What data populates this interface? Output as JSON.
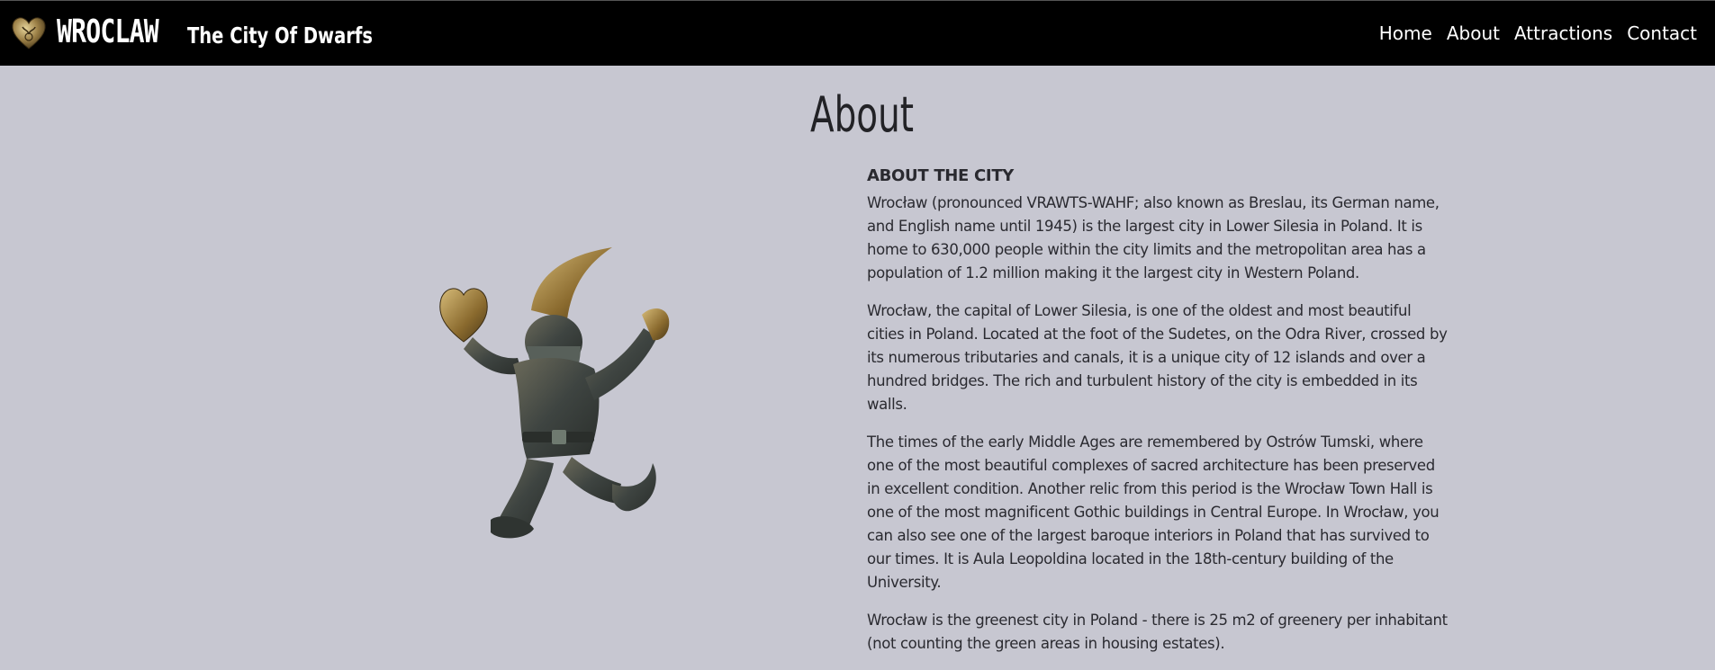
{
  "header": {
    "brand_name": "WROCLAW",
    "brand_tagline": "The City Of Dwarfs",
    "logo_icon": "bronze-heart-icon",
    "nav": [
      {
        "label": "Home"
      },
      {
        "label": "About"
      },
      {
        "label": "Attractions"
      },
      {
        "label": "Contact"
      }
    ]
  },
  "main": {
    "title": "About",
    "image_icon": "bronze-dwarf-statue",
    "section_heading": "ABOUT THE CITY",
    "paragraphs": [
      "Wrocław (pronounced VRAWTS-WAHF; also known as Breslau, its German name, and English name until 1945) is the largest city in Lower Silesia in Poland. It is home to 630,000 people within the city limits and the metropolitan area has a population of 1.2 million making it the largest city in Western Poland.",
      "Wrocław, the capital of Lower Silesia, is one of the oldest and most beautiful cities in Poland. Located at the foot of the Sudetes, on the Odra River, crossed by its numerous tributaries and canals, it is a unique city of 12 islands and over a hundred bridges. The rich and turbulent history of the city is embedded in its walls.",
      "The times of the early Middle Ages are remembered by Ostrów Tumski, where one of the most beautiful complexes of sacred architecture has been preserved in excellent condition. Another relic from this period is the Wrocław Town Hall is one of the most magnificent Gothic buildings in Central Europe. In Wrocław, you can also see one of the largest baroque interiors in Poland that has survived to our times. It is Aula Leopoldina located in the 18th-century building of the University.",
      "Wrocław is the greenest city in Poland - there is 25 m2 of greenery per inhabitant (not counting the green areas in housing estates)."
    ]
  },
  "colors": {
    "navbar_bg": "#000000",
    "page_bg": "#c7c7d1",
    "text": "#2a2a30",
    "bronze": "#8a6a2e"
  }
}
